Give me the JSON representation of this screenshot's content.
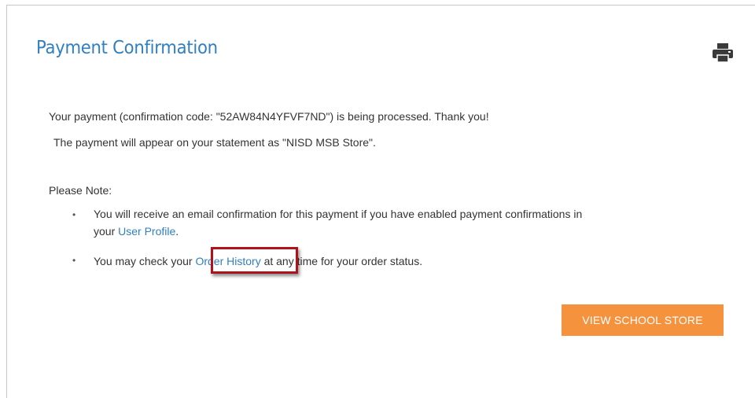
{
  "header": {
    "title": "Payment Confirmation",
    "print_icon": "printer-icon"
  },
  "message": {
    "line1": "Your payment (confirmation code: \"52AW84N4YFVF7ND\") is being processed. Thank you!",
    "line2": "The payment will appear on your statement as \"NISD MSB Store\"."
  },
  "note": {
    "label": "Please Note:",
    "item1_text_a": "You will receive an email confirmation for this payment if you have enabled payment confirmations in",
    "item1_text_b": "your ",
    "item1_link": "User Profile",
    "item1_end": ".",
    "item2_before": "You may check your ",
    "item2_link": "Order History",
    "item2_after": " at any time for your order status.",
    "bullet": "•"
  },
  "actions": {
    "view_store_label": "VIEW SCHOOL STORE"
  },
  "colors": {
    "title": "#2f7fc1",
    "link": "#2f7fc1",
    "button": "#f5923e",
    "highlight": "#b0121b"
  }
}
